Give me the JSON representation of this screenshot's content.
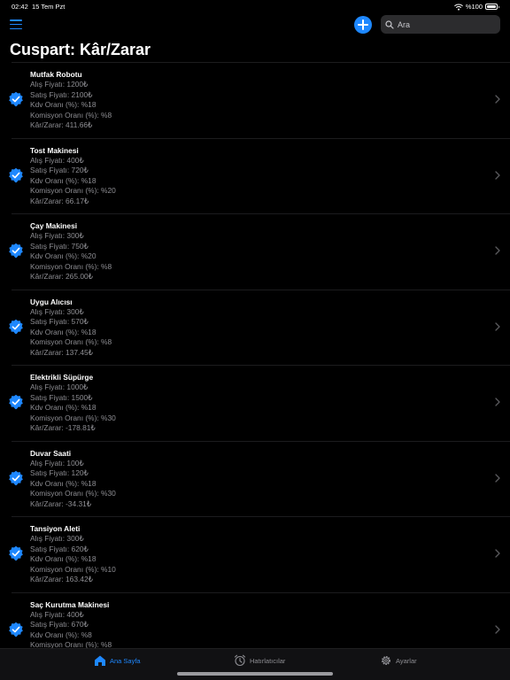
{
  "status_bar": {
    "time": "02:42",
    "date": "15 Tem Pzt",
    "battery": "%100"
  },
  "nav": {
    "search_placeholder": "Ara",
    "title": "Cuspart: Kâr/Zarar"
  },
  "products": [
    {
      "name": "Mutfak Robotu",
      "alis": "Alış Fiyatı: 1200₺",
      "satis": "Satış Fiyatı: 2100₺",
      "kdv": "Kdv Oranı (%): %18",
      "komisyon": "Komisyon Oranı (%): %8",
      "kar": "Kâr/Zarar: 411.66₺"
    },
    {
      "name": "Tost Makinesi",
      "alis": "Alış Fiyatı: 400₺",
      "satis": "Satış Fiyatı: 720₺",
      "kdv": "Kdv Oranı (%): %18",
      "komisyon": "Komisyon Oranı (%): %20",
      "kar": "Kâr/Zarar: 66.17₺"
    },
    {
      "name": "Çay Makinesi",
      "alis": "Alış Fiyatı: 300₺",
      "satis": "Satış Fiyatı: 750₺",
      "kdv": "Kdv Oranı (%): %20",
      "komisyon": "Komisyon Oranı (%): %8",
      "kar": "Kâr/Zarar: 265.00₺"
    },
    {
      "name": "Uygu Alıcısı",
      "alis": "Alış Fiyatı: 300₺",
      "satis": "Satış Fiyatı: 570₺",
      "kdv": "Kdv Oranı (%): %18",
      "komisyon": "Komisyon Oranı (%): %8",
      "kar": "Kâr/Zarar: 137.45₺"
    },
    {
      "name": "Elektrikli Süpürge",
      "alis": "Alış Fiyatı: 1000₺",
      "satis": "Satış Fiyatı: 1500₺",
      "kdv": "Kdv Oranı (%): %18",
      "komisyon": "Komisyon Oranı (%): %30",
      "kar": "Kâr/Zarar: -178.81₺"
    },
    {
      "name": "Duvar Saati",
      "alis": "Alış Fiyatı: 100₺",
      "satis": "Satış Fiyatı: 120₺",
      "kdv": "Kdv Oranı (%): %18",
      "komisyon": "Komisyon Oranı (%): %30",
      "kar": "Kâr/Zarar: -34.31₺"
    },
    {
      "name": "Tansiyon Aleti",
      "alis": "Alış Fiyatı: 300₺",
      "satis": "Satış Fiyatı: 620₺",
      "kdv": "Kdv Oranı (%): %18",
      "komisyon": "Komisyon Oranı (%): %10",
      "kar": "Kâr/Zarar: 163.42₺"
    },
    {
      "name": "Saç Kurutma Makinesi",
      "alis": "Alış Fiyatı: 400₺",
      "satis": "Satış Fiyatı: 670₺",
      "kdv": "Kdv Oranı (%): %8",
      "komisyon": "Komisyon Oranı (%): %8",
      "kar": ""
    }
  ],
  "tabs": [
    {
      "label": "Ana Sayfa",
      "icon": "home-icon",
      "active": true
    },
    {
      "label": "Hatırlatıcılar",
      "icon": "alarm-clock-icon",
      "active": false
    },
    {
      "label": "Ayarlar",
      "icon": "gear-icon",
      "active": false
    }
  ],
  "colors": {
    "accent": "#1e88ff",
    "background": "#000000",
    "secondary_text": "#8e8e93"
  }
}
